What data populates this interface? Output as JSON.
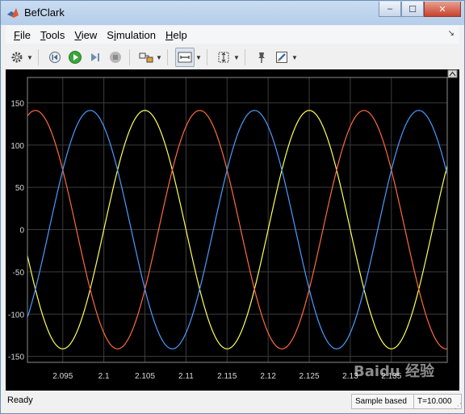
{
  "window": {
    "title": "BefClark",
    "min_symbol": "–",
    "max_symbol": "☐",
    "close_symbol": "✕"
  },
  "menu": {
    "items": [
      {
        "label": "File",
        "mnemonic": "F"
      },
      {
        "label": "Tools",
        "mnemonic": "T"
      },
      {
        "label": "View",
        "mnemonic": "V"
      },
      {
        "label": "Simulation",
        "mnemonic": "i"
      },
      {
        "label": "Help",
        "mnemonic": "H"
      }
    ]
  },
  "toolbar": {
    "icons": [
      "gear-icon",
      "rewind-icon",
      "run-icon",
      "step-forward-icon",
      "stop-icon",
      "highlight-icon",
      "zoom-icon",
      "autoscale-icon",
      "pin-icon",
      "style-icon"
    ]
  },
  "chart_data": {
    "type": "line",
    "title": "",
    "xlabel": "",
    "ylabel": "",
    "xlim": [
      2.0907,
      2.1418
    ],
    "ylim": [
      -157,
      180
    ],
    "x_ticks": [
      2.095,
      2.1,
      2.105,
      2.11,
      2.115,
      2.12,
      2.125,
      2.13,
      2.135
    ],
    "x_tick_labels": [
      "2.095",
      "2.1",
      "2.105",
      "2.11",
      "2.115",
      "2.12",
      "2.125",
      "2.13",
      "2.135"
    ],
    "y_ticks": [
      150,
      100,
      50,
      0,
      -50,
      -100,
      -150
    ],
    "y_tick_labels": [
      "150",
      "100",
      "50",
      "0",
      "-50",
      "-100",
      "-150"
    ],
    "grid": true,
    "background": "#000000",
    "grid_color": "#3c3c3c",
    "frequency_hz": 50,
    "series": [
      {
        "amplitude": 141,
        "phase_deg": 0,
        "color": "#ffff55"
      },
      {
        "amplitude": 141,
        "phase_deg": -120,
        "color": "#ff6a3d"
      },
      {
        "amplitude": 141,
        "phase_deg": 120,
        "color": "#4a9bff"
      }
    ]
  },
  "status": {
    "text": "Ready",
    "mode": "Sample based",
    "time": "T=10.000"
  },
  "watermark": "Baidu 经验"
}
